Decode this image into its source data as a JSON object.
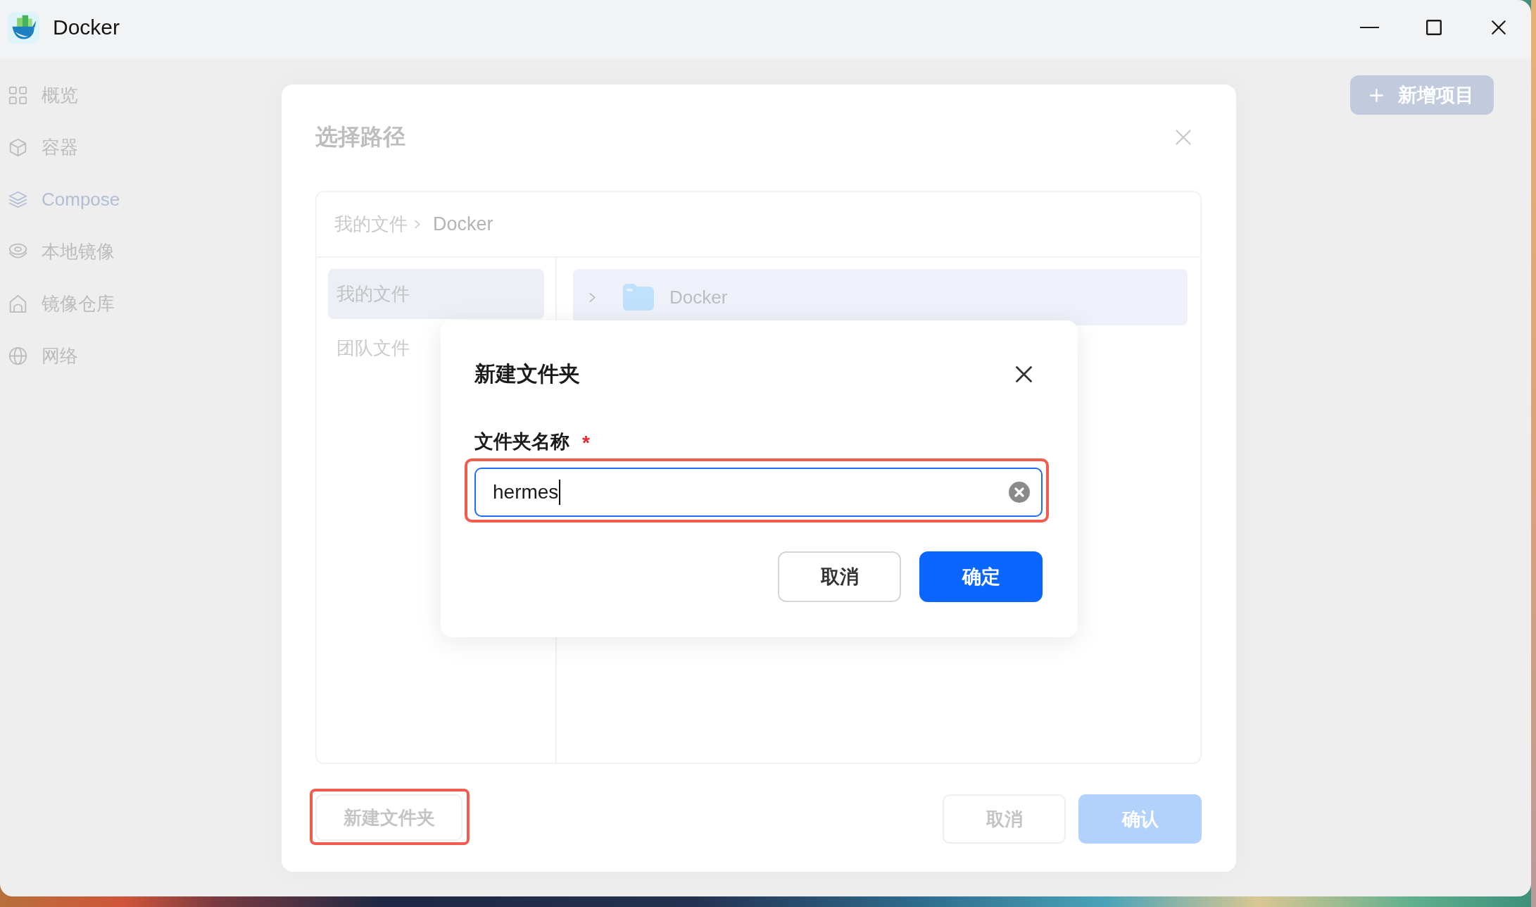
{
  "window": {
    "title": "Docker"
  },
  "sidebar": {
    "items": [
      {
        "label": "概览",
        "selected": false
      },
      {
        "label": "容器",
        "selected": false
      },
      {
        "label": "Compose",
        "selected": true
      },
      {
        "label": "本地镜像",
        "selected": false
      },
      {
        "label": "镜像仓库",
        "selected": false
      },
      {
        "label": "网络",
        "selected": false
      }
    ]
  },
  "toolbar": {
    "add_button": {
      "label": "新增项目"
    }
  },
  "path_dialog": {
    "title": "选择路径",
    "breadcrumb": [
      "我的文件",
      "Docker"
    ],
    "locations": [
      {
        "label": "我的文件",
        "selected": true
      },
      {
        "label": "团队文件",
        "selected": false
      }
    ],
    "folders": [
      {
        "name": "Docker",
        "selected": true,
        "expanded": false
      }
    ],
    "new_folder_button": {
      "label": "新建文件夹",
      "highlighted": true
    },
    "buttons": [
      {
        "label": "取消",
        "kind": "secondary"
      },
      {
        "label": "确认",
        "kind": "primary"
      }
    ]
  },
  "new_folder_dialog": {
    "title": "新建文件夹",
    "field": {
      "label": "文件夹名称",
      "required_mark": "*",
      "value": "hermes",
      "focused": true,
      "highlighted": true
    },
    "buttons": [
      {
        "label": "取消",
        "kind": "secondary"
      },
      {
        "label": "确定",
        "kind": "primary"
      }
    ]
  }
}
